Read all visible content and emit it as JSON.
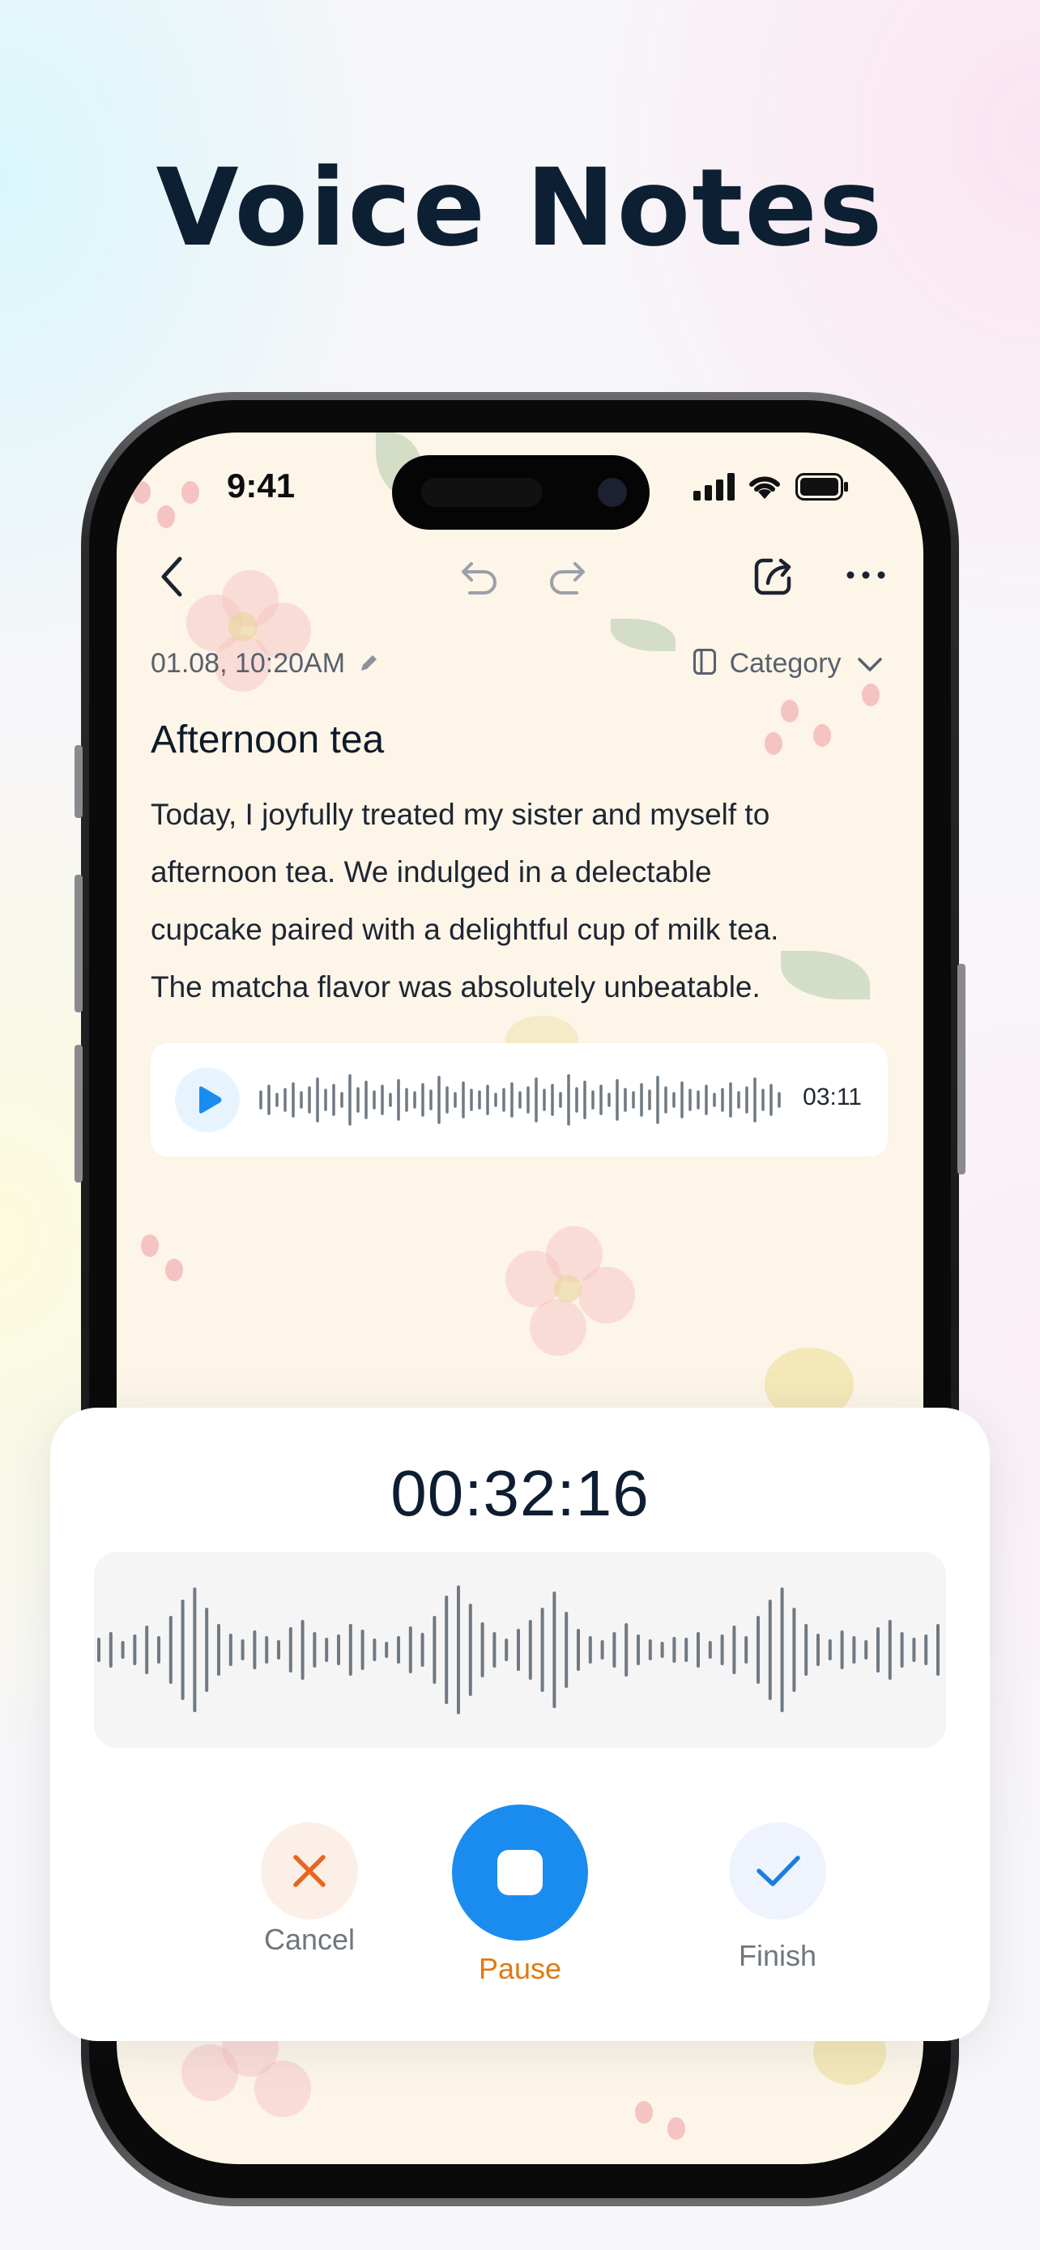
{
  "headline": "Voice Notes",
  "status_bar": {
    "time": "9:41"
  },
  "note": {
    "date": "01.08, 10:20AM",
    "category_label": "Category",
    "title": "Afternoon tea",
    "body_lines": [
      "Today, I joyfully treated my sister and myself to",
      "afternoon tea. We indulged in a delectable",
      "cupcake paired with a delightful cup of milk tea.",
      "The matcha flavor was absolutely unbeatable."
    ],
    "audio_duration": "03:11"
  },
  "recorder": {
    "elapsed": "00:32:16",
    "cancel_label": "Cancel",
    "pause_label": "Pause",
    "finish_label": "Finish"
  },
  "colors": {
    "accent_blue": "#1a8cf0",
    "cancel_orange": "#e8661e",
    "pause_label_orange": "#e07a12",
    "waveform_gray": "#6f7983"
  },
  "icons": [
    "back-icon",
    "undo-icon",
    "redo-icon",
    "share-icon",
    "more-icon",
    "edit-pencil-icon",
    "category-icon",
    "chevron-down-icon",
    "play-icon",
    "close-icon",
    "stop-icon",
    "check-icon",
    "signal-icon",
    "wifi-icon",
    "battery-icon"
  ]
}
